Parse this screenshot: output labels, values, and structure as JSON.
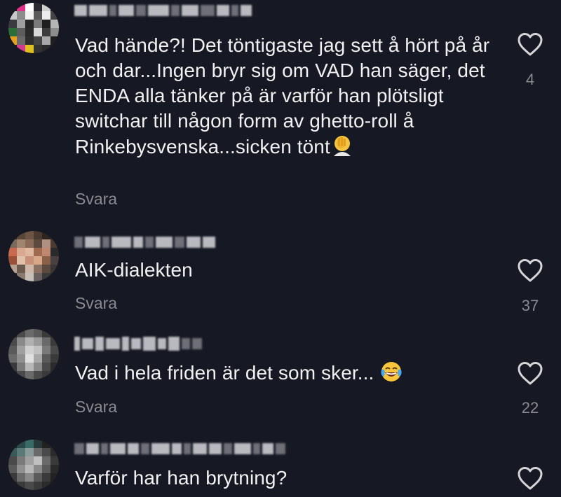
{
  "comments": [
    {
      "text": "Vad hände?! Det töntigaste jag sett å hört på år och dar...Ingen bryr sig om VAD han säger, det ENDA alla tänker på är varför han plötsligt switchar till någon form av ghetto-roll å Rinkebysvenska...sicken tönt",
      "emoji": "facepalm-emoji",
      "reply_label": "Svara",
      "likes": "4"
    },
    {
      "text": "AIK-dialekten",
      "reply_label": "Svara",
      "likes": "37"
    },
    {
      "text": "Vad i hela friden är det som sker...",
      "emoji": "tears-of-joy-emoji",
      "reply_label": "Svara",
      "likes": "22"
    },
    {
      "text": "Varför har han brytning?"
    }
  ],
  "icons": {
    "like": "heart-outline-icon"
  },
  "colors": {
    "background": "#161823",
    "text": "#f1f1f2",
    "muted": "#8a8b91"
  }
}
